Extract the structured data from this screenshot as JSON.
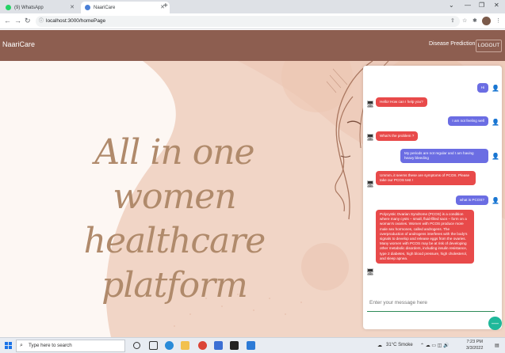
{
  "browser": {
    "tabs": [
      {
        "label": "(9) WhatsApp"
      },
      {
        "label": "NaariCare"
      }
    ],
    "url": "localhost:3000/homePage"
  },
  "navbar": {
    "brand": "NaariCare",
    "link": "Disease Prediction",
    "logout": "LOGOUT"
  },
  "hero": {
    "title_line1": "All in one women",
    "title_line2": "healthcare platform"
  },
  "chat": {
    "messages": [
      {
        "from": "user",
        "text": "Hi"
      },
      {
        "from": "bot",
        "text": "Hello! How can I help you?"
      },
      {
        "from": "user",
        "text": "I am not feeling well"
      },
      {
        "from": "bot",
        "text": "What's the problem ?"
      },
      {
        "from": "user",
        "text": "My periods are not regular and I am having heavy bleeding"
      },
      {
        "from": "bot",
        "text": "Ummm..it seems these are symptoms of PCOS. Please take our PCOS test !"
      },
      {
        "from": "user",
        "text": "what is PCOS?"
      },
      {
        "from": "bot",
        "text": "Polycystic Ovarian Syndrome (PCOS) is a condition where many cysts – small, fluid-filled sacs – form on a woman's ovaries. Women with PCOS produce more male sex hormones, called androgens. The overproduction of androgens interferes with the body's signals to develop and release eggs from the ovaries. Many women with PCOS may be at risk of developing other metabolic disorders, including insulin resistance, type 2 diabetes, high blood pressure, high cholesterol, and sleep apnea."
      }
    ],
    "input_placeholder": "Enter your message here"
  },
  "taskbar": {
    "search_placeholder": "Type here to search",
    "weather": "31°C Smoke",
    "time": "7:23 PM",
    "date": "3/3/2022"
  }
}
